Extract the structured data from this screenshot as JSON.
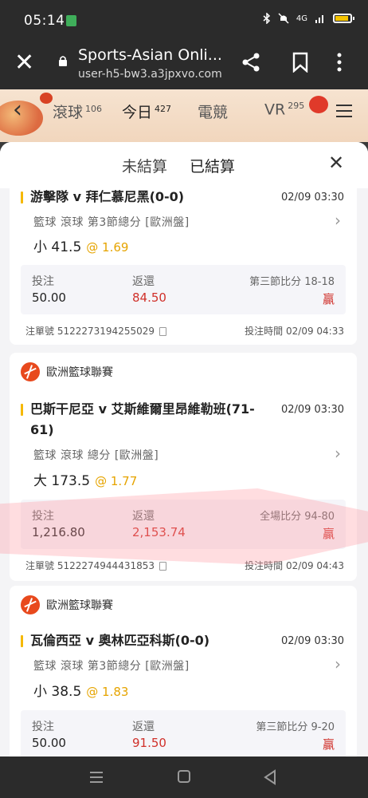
{
  "status": {
    "time": "05:14",
    "signal_label": "4G"
  },
  "browser": {
    "title": "Sports-Asian Onli...",
    "url": "user-h5-bw3.a3jpxvo.com"
  },
  "nav": {
    "tabs": [
      {
        "label": "滾球",
        "count": "106"
      },
      {
        "label": "今日",
        "count": "427"
      },
      {
        "label": "電競",
        "count": ""
      },
      {
        "label": "VR",
        "count": "295"
      }
    ]
  },
  "sheet": {
    "tab_unsettled": "未結算",
    "tab_settled": "已結算"
  },
  "labels": {
    "stake": "投注",
    "return": "返還",
    "order_prefix": "注單號",
    "bet_time_prefix": "投注時間"
  },
  "bets": [
    {
      "league": "",
      "match": "游擊隊 v 拜仁慕尼黑(0-0)",
      "match_time": "02/09 03:30",
      "market": "籃球  滾球  第3節總分  [歐洲盤]",
      "pick": "小 41.5",
      "odds": "@ 1.69",
      "stake": "50.00",
      "return": "84.50",
      "score": "第三節比分 18-18",
      "result": "贏",
      "order_no": "5122273194255029",
      "bet_time": "02/09 04:33"
    },
    {
      "league": "歐洲籃球聯賽",
      "match": "巴斯干尼亞 v 艾斯維爾里昂維勒班(71-61)",
      "match_time": "02/09 03:30",
      "market": "籃球  滾球  總分  [歐洲盤]",
      "pick": "大 173.5",
      "odds": "@ 1.77",
      "stake": "1,216.80",
      "return": "2,153.74",
      "score": "全場比分 94-80",
      "result": "贏",
      "order_no": "5122274944431853",
      "bet_time": "02/09 04:43"
    },
    {
      "league": "歐洲籃球聯賽",
      "match": "瓦倫西亞 v 奧林匹亞科斯(0-0)",
      "match_time": "02/09 03:30",
      "market": "籃球  滾球  第3節總分  [歐洲盤]",
      "pick": "小 38.5",
      "odds": "@ 1.83",
      "stake": "50.00",
      "return": "91.50",
      "score": "第三節比分 9-20",
      "result": "贏",
      "order_no": "",
      "bet_time": ""
    }
  ],
  "colors": {
    "accent": "#f5b800",
    "win": "#d0302a",
    "league_ball": "#e8491d"
  }
}
